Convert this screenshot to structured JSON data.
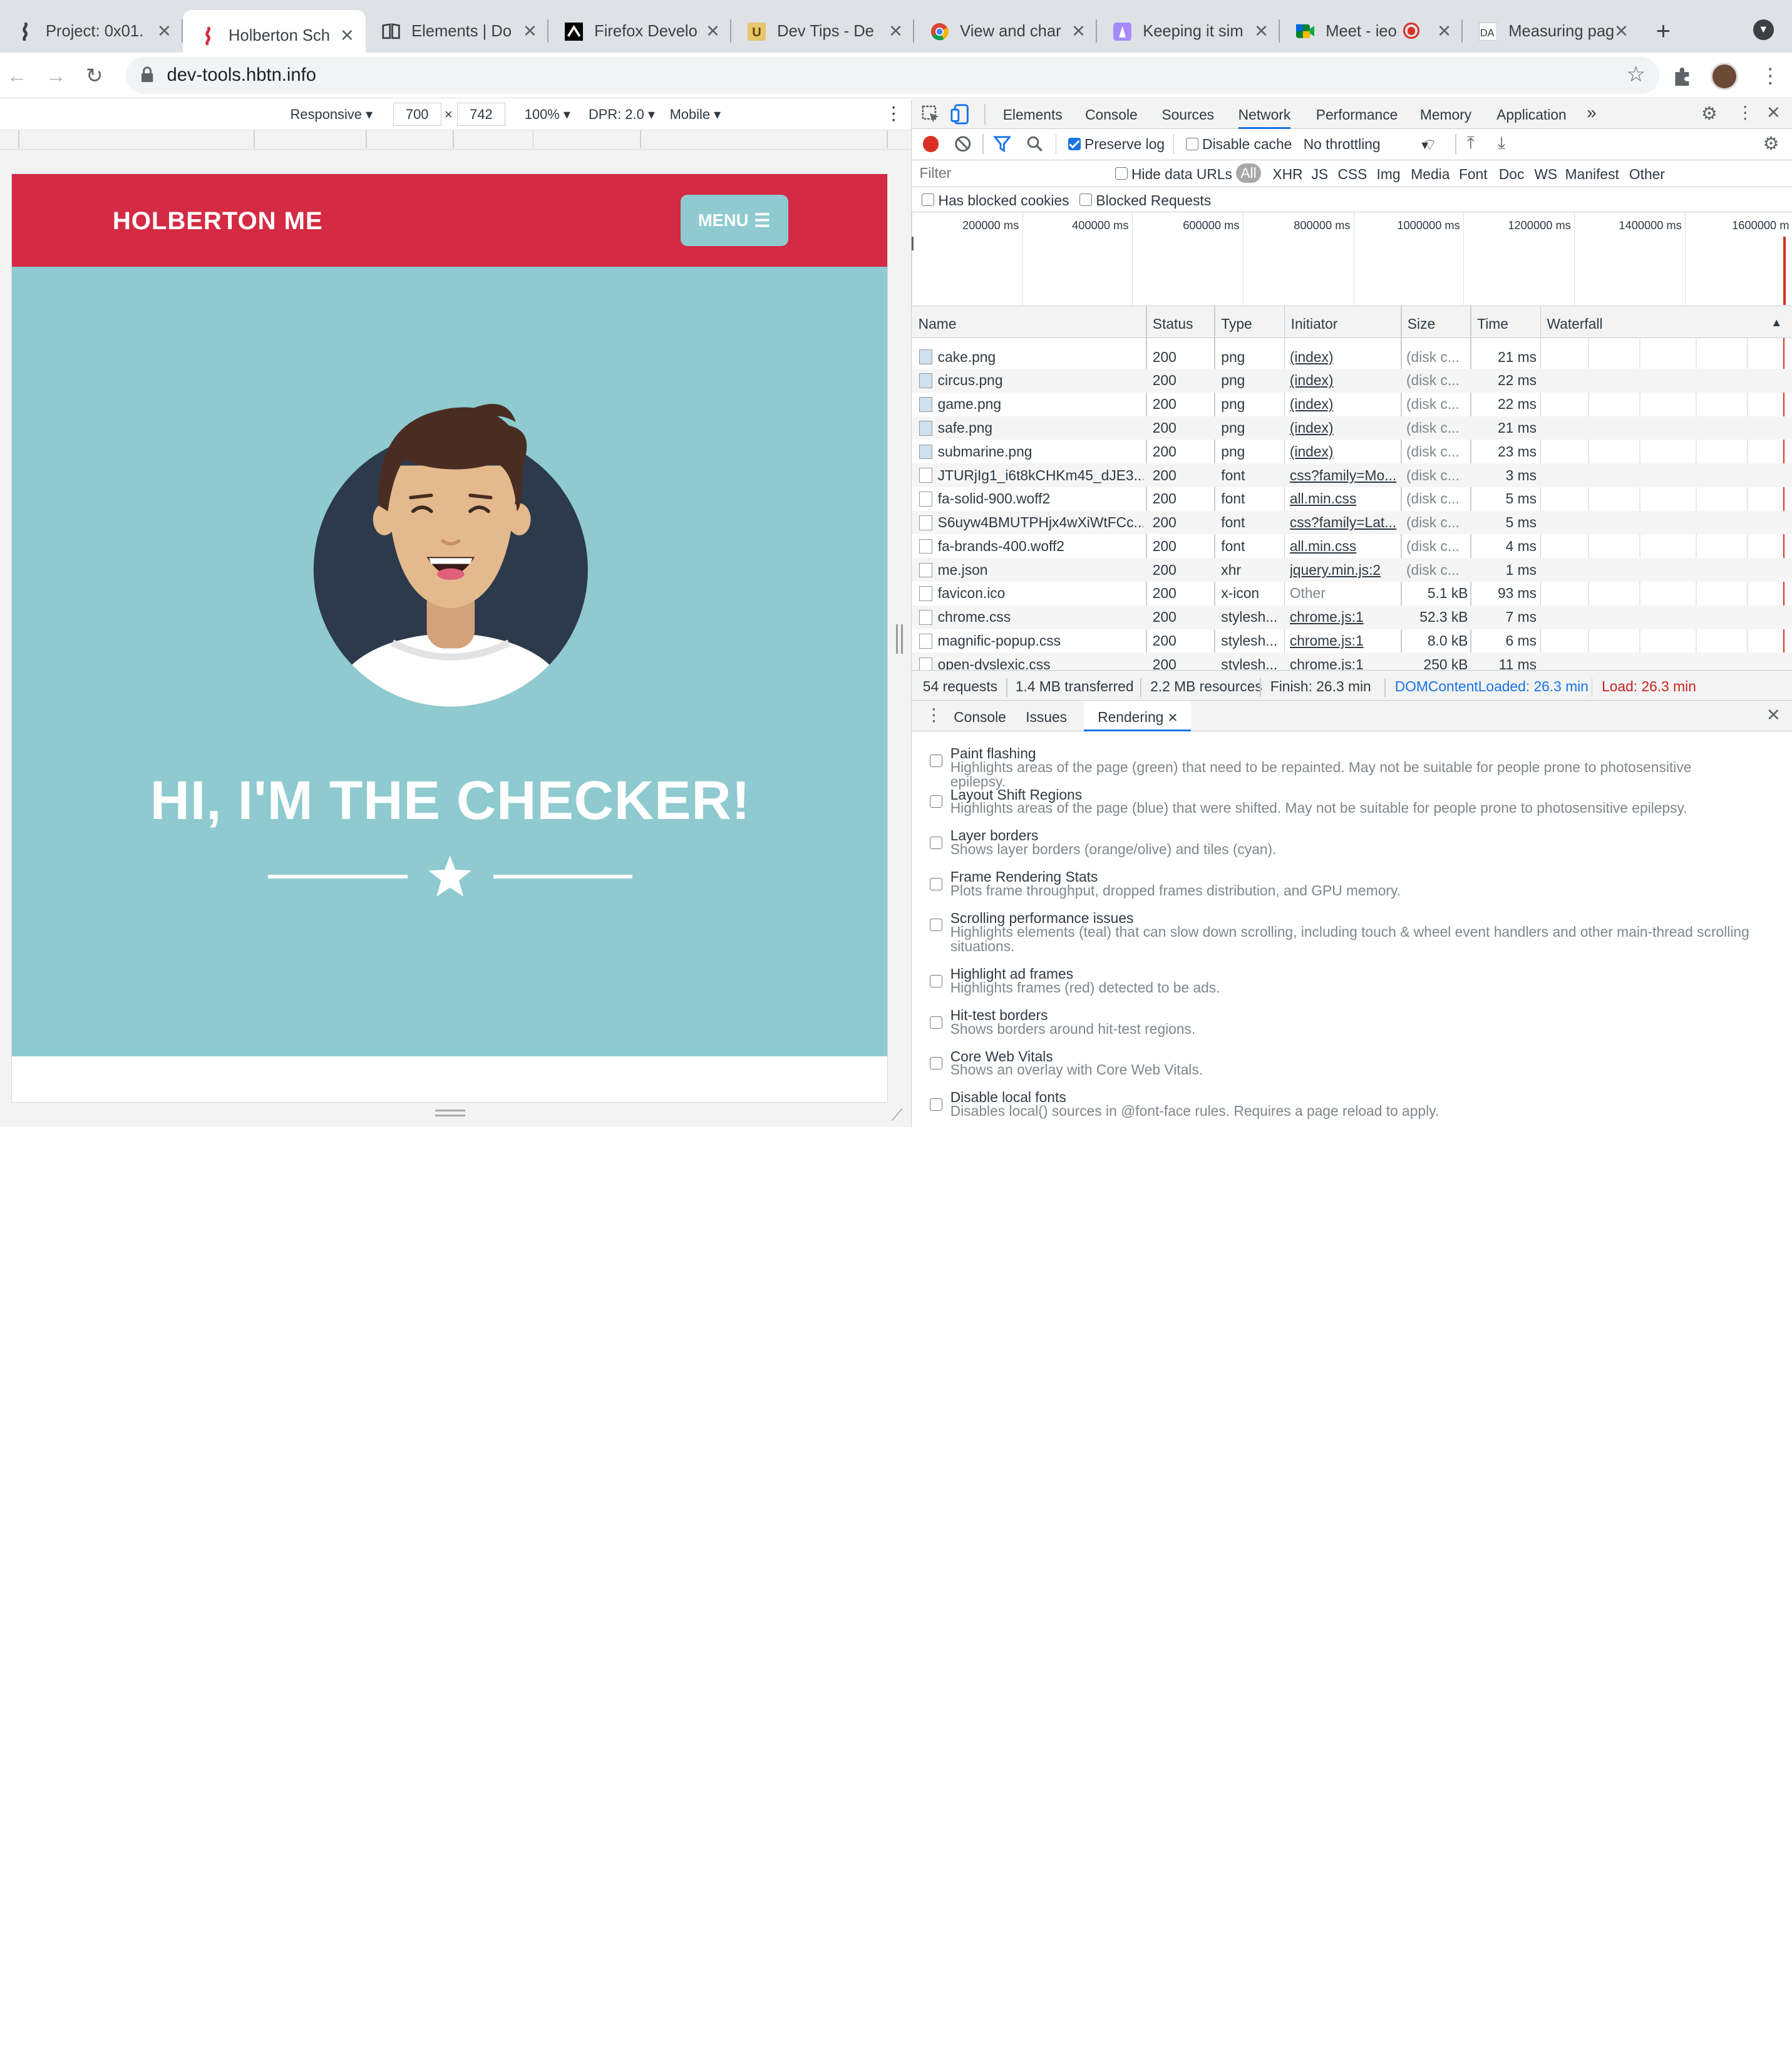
{
  "tabs": [
    {
      "title": "Project: 0x01.",
      "icon": "holberton-icon",
      "active": false
    },
    {
      "title": "Holberton Sch",
      "icon": "holberton-icon",
      "active": true
    },
    {
      "title": "Elements | Do",
      "icon": "book-icon",
      "active": false
    },
    {
      "title": "Firefox Develo",
      "icon": "mdn-icon",
      "active": false
    },
    {
      "title": "Dev Tips - De",
      "icon": "devtips-icon",
      "active": false
    },
    {
      "title": "View and char",
      "icon": "chrome-icon",
      "active": false
    },
    {
      "title": "Keeping it sim",
      "icon": "lighthouse-icon",
      "active": false
    },
    {
      "title": "Meet - ieo",
      "icon": "meet-icon",
      "active": false
    },
    {
      "title": "Measuring pag",
      "icon": "da-icon",
      "active": false
    }
  ],
  "address": {
    "url": "dev-tools.hbtn.info"
  },
  "device_toolbar": {
    "mode": "Responsive",
    "width": "700",
    "height": "742",
    "zoom": "100%",
    "dpr": "DPR: 2.0",
    "type": "Mobile",
    "times": "×"
  },
  "page": {
    "brand": "HOLBERTON ME",
    "menu": "MENU",
    "headline": "HI, I'M THE CHECKER!"
  },
  "devtools": {
    "tabs": [
      "Elements",
      "Console",
      "Sources",
      "Network",
      "Performance",
      "Memory",
      "Application"
    ],
    "more": "»",
    "toolbar": {
      "preserve_log": "Preserve log",
      "disable_cache": "Disable cache",
      "throttling": "No throttling"
    },
    "filter": {
      "placeholder": "Filter",
      "hide_data_urls": "Hide data URLs",
      "types": [
        "All",
        "XHR",
        "JS",
        "CSS",
        "Img",
        "Media",
        "Font",
        "Doc",
        "WS",
        "Manifest",
        "Other"
      ],
      "blocked_cookies": "Has blocked cookies",
      "blocked_requests": "Blocked Requests"
    },
    "timeline_ticks": [
      "200000 ms",
      "400000 ms",
      "600000 ms",
      "800000 ms",
      "1000000 ms",
      "1200000 ms",
      "1400000 ms",
      "1600000 m"
    ],
    "columns": [
      "Name",
      "Status",
      "Type",
      "Initiator",
      "Size",
      "Time",
      "Waterfall"
    ],
    "rows": [
      {
        "name": "cake.png",
        "status": "200",
        "type": "png",
        "initiator": "(index)",
        "size": "(disk c...",
        "time": "21 ms",
        "img": true
      },
      {
        "name": "circus.png",
        "status": "200",
        "type": "png",
        "initiator": "(index)",
        "size": "(disk c...",
        "time": "22 ms",
        "img": true
      },
      {
        "name": "game.png",
        "status": "200",
        "type": "png",
        "initiator": "(index)",
        "size": "(disk c...",
        "time": "22 ms",
        "img": true
      },
      {
        "name": "safe.png",
        "status": "200",
        "type": "png",
        "initiator": "(index)",
        "size": "(disk c...",
        "time": "21 ms",
        "img": true
      },
      {
        "name": "submarine.png",
        "status": "200",
        "type": "png",
        "initiator": "(index)",
        "size": "(disk c...",
        "time": "23 ms",
        "img": true
      },
      {
        "name": "JTURjIg1_i6t8kCHKm45_dJE3...",
        "status": "200",
        "type": "font",
        "initiator": "css?family=Mo...",
        "size": "(disk c...",
        "time": "3 ms",
        "img": false
      },
      {
        "name": "fa-solid-900.woff2",
        "status": "200",
        "type": "font",
        "initiator": "all.min.css",
        "size": "(disk c...",
        "time": "5 ms",
        "img": false
      },
      {
        "name": "S6uyw4BMUTPHjx4wXiWtFCc...",
        "status": "200",
        "type": "font",
        "initiator": "css?family=Lat...",
        "size": "(disk c...",
        "time": "5 ms",
        "img": false
      },
      {
        "name": "fa-brands-400.woff2",
        "status": "200",
        "type": "font",
        "initiator": "all.min.css",
        "size": "(disk c...",
        "time": "4 ms",
        "img": false
      },
      {
        "name": "me.json",
        "status": "200",
        "type": "xhr",
        "initiator": "jquery.min.js:2",
        "size": "(disk c...",
        "time": "1 ms",
        "img": false
      },
      {
        "name": "favicon.ico",
        "status": "200",
        "type": "x-icon",
        "initiator": "Other",
        "size": "5.1 kB",
        "time": "93 ms",
        "img": false
      },
      {
        "name": "chrome.css",
        "status": "200",
        "type": "stylesh...",
        "initiator": "chrome.js:1",
        "size": "52.3 kB",
        "time": "7 ms",
        "img": false
      },
      {
        "name": "magnific-popup.css",
        "status": "200",
        "type": "stylesh...",
        "initiator": "chrome.js:1",
        "size": "8.0 kB",
        "time": "6 ms",
        "img": false
      },
      {
        "name": "open-dyslexic.css",
        "status": "200",
        "type": "stylesh...",
        "initiator": "chrome.js:1",
        "size": "250 kB",
        "time": "11 ms",
        "img": false
      }
    ],
    "summary": {
      "requests": "54 requests",
      "transferred": "1.4 MB transferred",
      "resources": "2.2 MB resources",
      "finish": "Finish: 26.3 min",
      "dcl": "DOMContentLoaded: 26.3 min",
      "load": "Load: 26.3 min"
    },
    "drawer_tabs": [
      "Console",
      "Issues",
      "Rendering"
    ],
    "rendering": [
      {
        "title": "Paint flashing",
        "desc": "Highlights areas of the page (green) that need to be repainted. May not be suitable for people prone to photosensitive epilepsy."
      },
      {
        "title": "Layout Shift Regions",
        "desc": "Highlights areas of the page (blue) that were shifted. May not be suitable for people prone to photosensitive epilepsy."
      },
      {
        "title": "Layer borders",
        "desc": "Shows layer borders (orange/olive) and tiles (cyan)."
      },
      {
        "title": "Frame Rendering Stats",
        "desc": "Plots frame throughput, dropped frames distribution, and GPU memory."
      },
      {
        "title": "Scrolling performance issues",
        "desc": "Highlights elements (teal) that can slow down scrolling, including touch & wheel event handlers and other main-thread scrolling situations."
      },
      {
        "title": "Highlight ad frames",
        "desc": "Highlights frames (red) detected to be ads."
      },
      {
        "title": "Hit-test borders",
        "desc": "Shows borders around hit-test regions."
      },
      {
        "title": "Core Web Vitals",
        "desc": "Shows an overlay with Core Web Vitals."
      },
      {
        "title": "Disable local fonts",
        "desc": "Disables local() sources in @font-face rules. Requires a page reload to apply."
      }
    ]
  },
  "colors": {
    "brand_red": "#d42a43",
    "hero_teal": "#8ecacf",
    "avatar_navy": "#2d3a4b",
    "devtools_blue": "#1a73e8",
    "load_red": "#c5221f"
  }
}
